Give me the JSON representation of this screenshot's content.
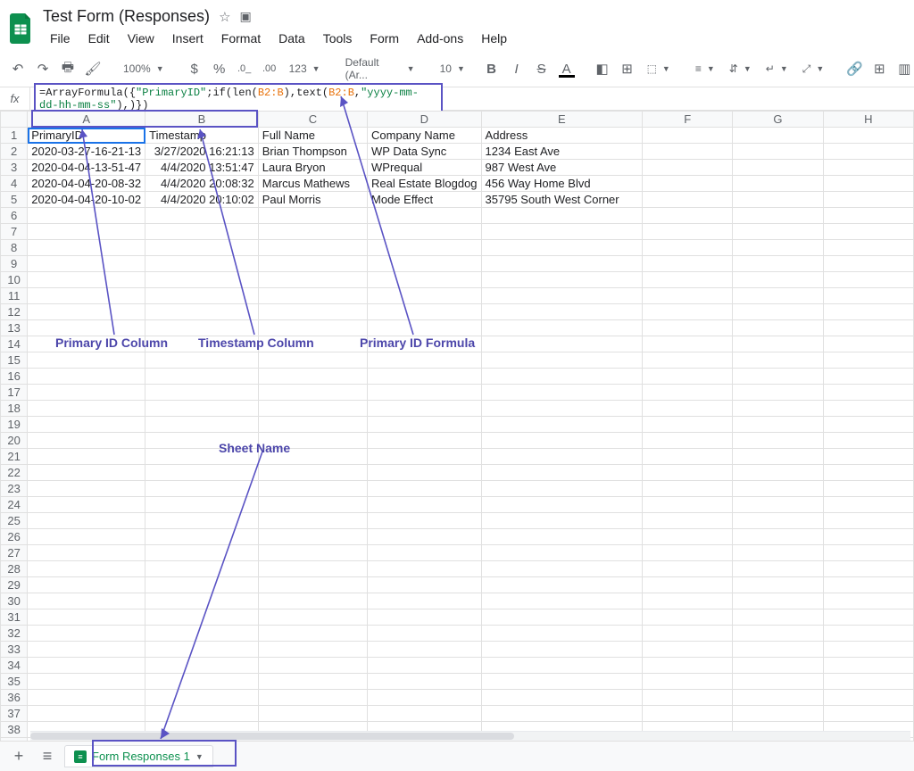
{
  "header": {
    "title": "Test Form (Responses)",
    "menus": [
      "File",
      "Edit",
      "View",
      "Insert",
      "Format",
      "Data",
      "Tools",
      "Form",
      "Add-ons",
      "Help"
    ]
  },
  "toolbar": {
    "zoom": "100%",
    "font": "Default (Ar...",
    "fontsize": "10",
    "numfmt_123": "123"
  },
  "formula_bar": {
    "fx_label": "fx",
    "formula_prefix": "=ArrayFormula({",
    "formula_str1": "\"PrimaryID\"",
    "formula_mid1": ";if(len(",
    "formula_ref1": "B2:B",
    "formula_mid2": "),text(",
    "formula_ref2": "B2:B",
    "formula_mid3": ",",
    "formula_str2": "\"yyyy-mm-dd-hh-mm-ss\"",
    "formula_suffix": "),)})"
  },
  "columns": [
    "A",
    "B",
    "C",
    "D",
    "E",
    "F",
    "G",
    "H"
  ],
  "headers": {
    "A": "PrimaryID",
    "B": "Timestamp",
    "C": "Full Name",
    "D": "Company Name",
    "E": "Address"
  },
  "rows": [
    {
      "A": "2020-03-27-16-21-13",
      "B": "3/27/2020 16:21:13",
      "C": "Brian Thompson",
      "D": "WP Data Sync",
      "E": "1234 East Ave"
    },
    {
      "A": "2020-04-04-13-51-47",
      "B": "4/4/2020 13:51:47",
      "C": "Laura Bryon",
      "D": "WPrequal",
      "E": "987 West Ave"
    },
    {
      "A": "2020-04-04-20-08-32",
      "B": "4/4/2020 20:08:32",
      "C": "Marcus Mathews",
      "D": "Real Estate Blogdog",
      "E": "456 Way Home Blvd"
    },
    {
      "A": "2020-04-04-20-10-02",
      "B": "4/4/2020 20:10:02",
      "C": "Paul Morris",
      "D": "Mode Effect",
      "E": "35795 South West Corner"
    }
  ],
  "row_count": 40,
  "annotations": {
    "primary_id_col": "Primary ID Column",
    "timestamp_col": "Timestamp Column",
    "primary_id_formula": "Primary ID Formula",
    "sheet_name": "Sheet Name"
  },
  "tabs": {
    "sheet1": "Form Responses 1"
  }
}
